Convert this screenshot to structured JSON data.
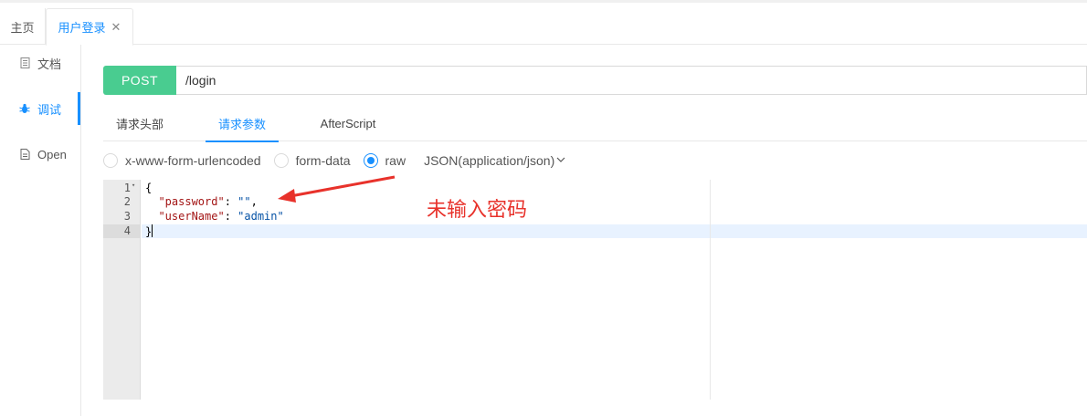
{
  "tabs": {
    "home_label": "主页",
    "login_label": "用户登录",
    "close_glyph": "✕"
  },
  "sidebar": {
    "items": [
      {
        "label": "文档",
        "icon": "document-icon"
      },
      {
        "label": "调试",
        "icon": "bug-icon"
      },
      {
        "label": "Open",
        "icon": "file-icon"
      }
    ]
  },
  "request": {
    "method": "POST",
    "url": "/login",
    "method_color": "#49cc90"
  },
  "subtabs": {
    "headers": "请求头部",
    "params": "请求参数",
    "afterscript": "AfterScript"
  },
  "body_types": {
    "urlencoded": "x-www-form-urlencoded",
    "formdata": "form-data",
    "raw": "raw",
    "selected": "raw",
    "content_type": "JSON(application/json)"
  },
  "editor": {
    "line_numbers": [
      "1",
      "2",
      "3",
      "4"
    ],
    "lines": {
      "l1": "{",
      "l2_key": "\"password\"",
      "l2_sep": ": ",
      "l2_val": "\"\"",
      "l2_end": ",",
      "l3_key": "\"userName\"",
      "l3_sep": ": ",
      "l3_val": "\"admin\"",
      "l4": "}"
    }
  },
  "annotation": {
    "text": "未输入密码",
    "color": "#e8322b"
  },
  "accent_color": "#1890ff"
}
